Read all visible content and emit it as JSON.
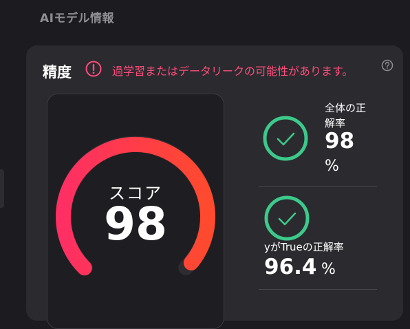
{
  "section_title": "AIモデル情報",
  "card": {
    "title": "精度",
    "warning_icon": "exclamation-circle-icon",
    "warning_text": "過学習またはデータリークの可能性があります。",
    "help_icon": "question-circle-icon"
  },
  "score": {
    "label": "スコア",
    "value": "98",
    "gauge_fraction": 0.98,
    "gradient_start": "#ff2f63",
    "gradient_end": "#ff4a2e"
  },
  "metrics": [
    {
      "label_line1": "全体の正",
      "label_line2": "解率",
      "value": "98",
      "unit": "%",
      "icon": "check-circle-icon",
      "color": "#3cc98a"
    },
    {
      "label": "yがTrueの正解率",
      "value": "96.4",
      "unit": "%",
      "icon": "check-circle-icon",
      "color": "#3cc98a"
    }
  ],
  "colors": {
    "background": "#1c1c20",
    "card": "#2a2a2f",
    "warning": "#ff4d7a",
    "success": "#3cc98a"
  }
}
